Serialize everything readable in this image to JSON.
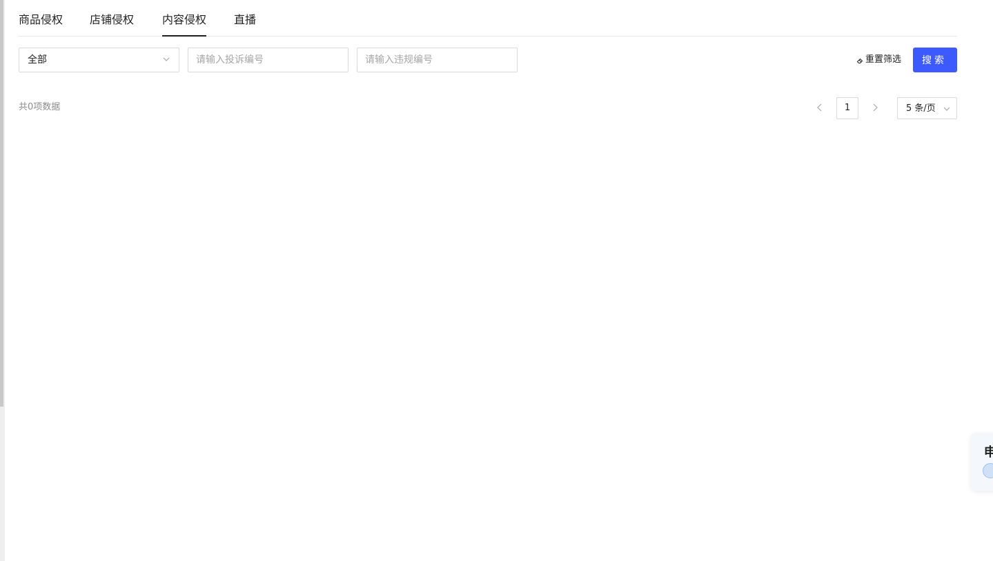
{
  "tabs": [
    {
      "label": "商品侵权",
      "active": false
    },
    {
      "label": "店铺侵权",
      "active": false
    },
    {
      "label": "内容侵权",
      "active": true
    },
    {
      "label": "直播",
      "active": false
    }
  ],
  "filters": {
    "type_select_value": "全部",
    "complaint_no_placeholder": "请输入投诉编号",
    "violation_no_placeholder": "请输入违规编号",
    "reset_label": "重置筛选",
    "search_label": "搜索"
  },
  "results": {
    "total_text": "共0项数据",
    "current_page": "1",
    "page_size_label": "5 条/页"
  },
  "float_widget": {
    "text": "申"
  },
  "colors": {
    "accent": "#3d5afe",
    "border": "#d9d9d9",
    "muted_text": "#8c8c8c"
  },
  "icons": {
    "select_chevron": "chevron-down-icon",
    "reset": "eraser-icon",
    "prev_page": "chevron-left-icon",
    "next_page": "chevron-right-icon"
  }
}
